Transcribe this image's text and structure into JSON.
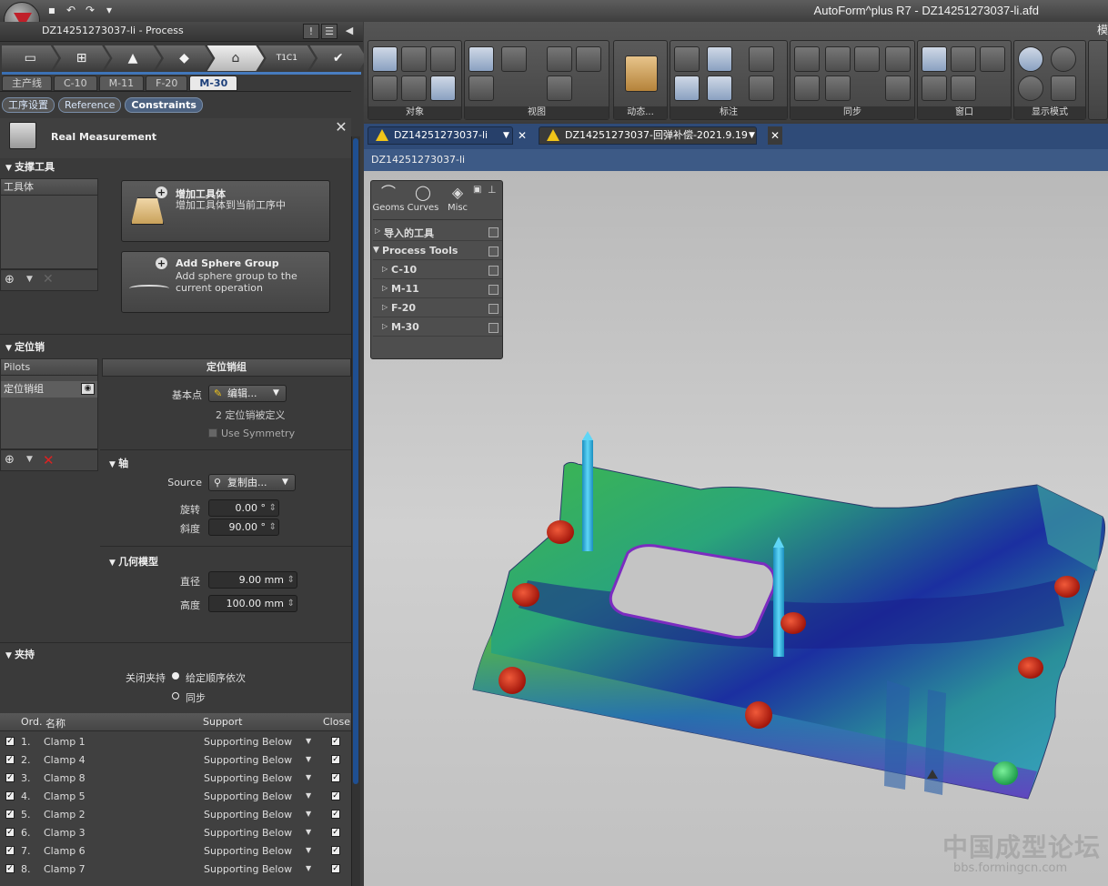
{
  "app": {
    "title": "AutoForm^plus R7 - DZ14251273037-li.afd",
    "panel_title": "DZ14251273037-li - Process",
    "ribbon_cut_label": "模型"
  },
  "workflow": {
    "steps": [
      "step-1",
      "step-2",
      "step-3",
      "step-4",
      "step-5",
      "step-6",
      "step-7"
    ],
    "active_index": 4,
    "step_glyphs": [
      "▭",
      "⊞",
      "▲",
      "◆",
      "⌂",
      "▣",
      "✔"
    ],
    "step_badge": "T1C1"
  },
  "op_tabs": [
    "主产线",
    "C-10",
    "M-11",
    "F-20",
    "M-30"
  ],
  "op_tabs_active": 4,
  "sub_tabs": [
    "工序设置",
    "Reference",
    "Constraints"
  ],
  "sub_tabs_active": 2,
  "real_measurement": {
    "title": "Real Measurement"
  },
  "support_tools": {
    "section": "支撑工具",
    "list_header": "工具体",
    "add_tool_title": "增加工具体",
    "add_tool_desc": "增加工具体到当前工序中",
    "add_sphere_title": "Add Sphere Group",
    "add_sphere_desc": "Add sphere group to the current operation"
  },
  "pilots": {
    "section": "定位销",
    "list_header": "Pilots",
    "list_item": "定位销组",
    "group_header": "定位销组",
    "base_point_label": "基本点",
    "base_point_value": "编辑...",
    "defined_text": "2 定位销被定义",
    "use_symmetry": "Use Symmetry",
    "axis": {
      "section": "轴",
      "source_label": "Source",
      "source_value": "复制由...",
      "rotate_label": "旋转",
      "rotate_value": "0.00 °",
      "incline_label": "斜度",
      "incline_value": "90.00 °"
    },
    "geometry": {
      "section": "几何模型",
      "diameter_label": "直径",
      "diameter_value": "9.00 mm",
      "height_label": "高度",
      "height_value": "100.00 mm"
    }
  },
  "clamps": {
    "section": "夹持",
    "close_label": "关闭夹持",
    "option1": "给定顺序依次",
    "option2": "同步",
    "table_headers": {
      "ord": "Ord.",
      "name": "名称",
      "support": "Support",
      "close": "Close"
    },
    "rows": [
      {
        "ord": "1.",
        "name": "Clamp 1",
        "support": "Supporting Below"
      },
      {
        "ord": "2.",
        "name": "Clamp 4",
        "support": "Supporting Below"
      },
      {
        "ord": "3.",
        "name": "Clamp 8",
        "support": "Supporting Below"
      },
      {
        "ord": "4.",
        "name": "Clamp 5",
        "support": "Supporting Below"
      },
      {
        "ord": "5.",
        "name": "Clamp 2",
        "support": "Supporting Below"
      },
      {
        "ord": "6.",
        "name": "Clamp 3",
        "support": "Supporting Below"
      },
      {
        "ord": "7.",
        "name": "Clamp 6",
        "support": "Supporting Below"
      },
      {
        "ord": "8.",
        "name": "Clamp 7",
        "support": "Supporting Below"
      }
    ]
  },
  "ribbon": {
    "groups": [
      "对象",
      "视图",
      "动态...",
      "标注",
      "同步",
      "窗口",
      "显示模式"
    ]
  },
  "doc_tabs": [
    "DZ14251273037-li",
    "DZ14251273037-回弹补偿-2021.9.19"
  ],
  "view_label": "DZ14251273037-li",
  "float_panel": {
    "tabs": [
      "Geoms",
      "Curves",
      "Misc"
    ],
    "rows": [
      {
        "label": "导入的工具"
      },
      {
        "label": "Process Tools"
      },
      {
        "label": "C-10"
      },
      {
        "label": "M-11"
      },
      {
        "label": "F-20"
      },
      {
        "label": "M-30"
      }
    ]
  },
  "watermark": {
    "line1": "中国成型论坛",
    "line2": "bbs.formingcn.com"
  },
  "colors": {
    "accent": "#1f4f91",
    "clamp_red": "#d42a1a",
    "clamp_green": "#3ecf6a",
    "pilot_cyan": "#2fb6e0"
  }
}
